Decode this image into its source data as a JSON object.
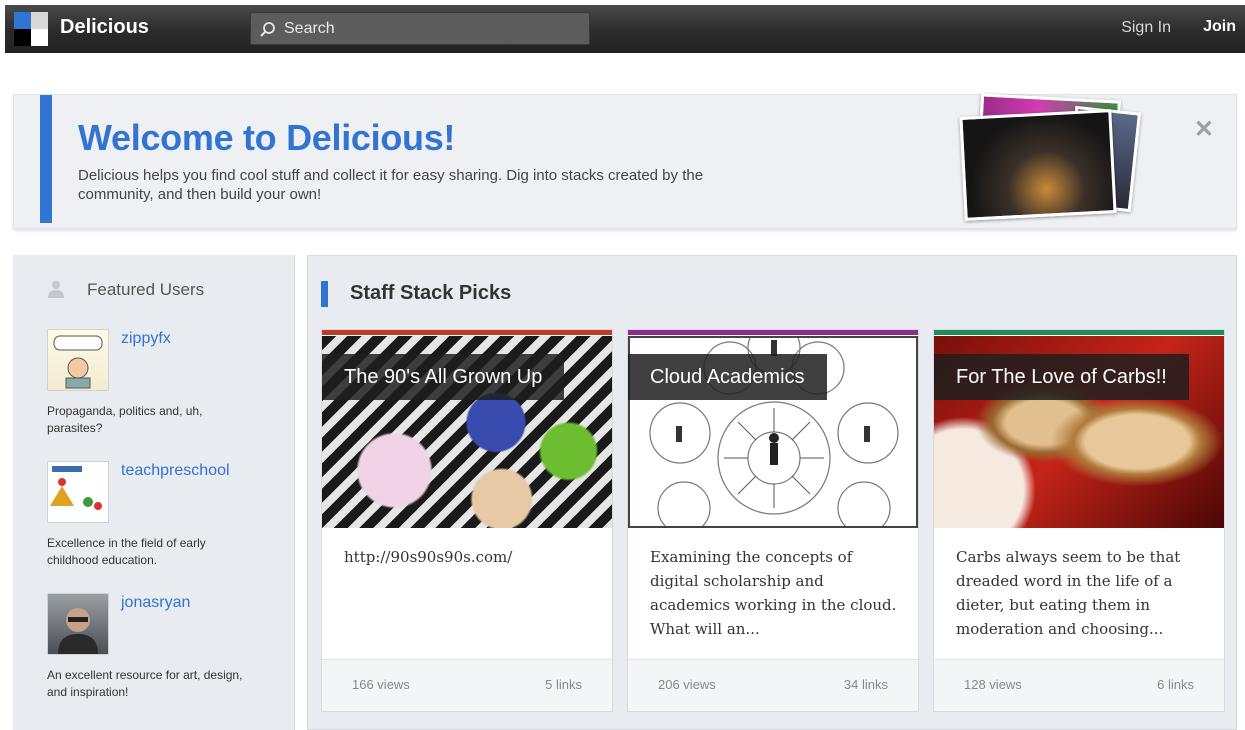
{
  "header": {
    "brand": "Delicious",
    "search_placeholder": "Search",
    "sign_in": "Sign In",
    "join": "Join",
    "logo_colors": [
      "#3274d1",
      "#d8d8d8",
      "#000000",
      "#ffffff"
    ]
  },
  "welcome": {
    "title": "Welcome to Delicious!",
    "text": "Delicious helps you find cool stuff and collect it for easy sharing. Dig into stacks created by the community, and then build your own!",
    "close_icon": "close-icon",
    "accent": "#3274d1"
  },
  "sidebar": {
    "title": "Featured Users",
    "users": [
      {
        "name": "zippyfx",
        "description": "Propaganda, politics and, uh, parasites?"
      },
      {
        "name": "teachpreschool",
        "description": "Excellence in the field of early childhood education."
      },
      {
        "name": "jonasryan",
        "description": "An excellent resource for art, design, and inspiration!"
      }
    ]
  },
  "main": {
    "title": "Staff Stack Picks",
    "cards": [
      {
        "title": "The 90's All Grown Up",
        "text": "http://90s90s90s.com/",
        "views": "166 views",
        "links": "5 links",
        "color": "#c0392b"
      },
      {
        "title": "Cloud Academics",
        "text": "Examining the concepts of digital scholarship and academics working in the cloud. What will an...",
        "views": "206 views",
        "links": "34 links",
        "color": "#8e2a8c"
      },
      {
        "title": "For The Love of Carbs!!",
        "text": "Carbs always seem to be that dreaded word in the life of a dieter, but eating them in moderation and choosing...",
        "views": "128 views",
        "links": "6 links",
        "color": "#1e8c5a"
      }
    ]
  }
}
